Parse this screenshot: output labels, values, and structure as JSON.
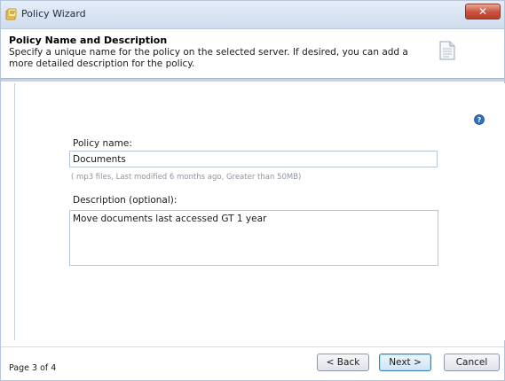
{
  "window": {
    "title": "Policy Wizard",
    "close_label": "✕",
    "app_icon": "wizard-icon"
  },
  "header": {
    "title": "Policy Name and Description",
    "description": "Specify a unique name for the policy on the selected server. If desired, you can add a more detailed description for the policy.",
    "icon": "document-icon"
  },
  "form": {
    "help_icon": "help-icon",
    "policy_name_label": "Policy name:",
    "policy_name_value": "Documents",
    "criteria_hint": "( mp3 files, Last modified  6 months ago, Greater than 50MB)",
    "description_label": "Description (optional):",
    "description_value": "Move documents last accessed GT 1 year"
  },
  "footer": {
    "page_indicator": "Page 3 of 4",
    "back_label": "< Back",
    "next_label": "Next >",
    "cancel_label": "Cancel"
  },
  "colors": {
    "titlebar": "#cfdcec",
    "close_button": "#c7503c",
    "field_border": "#b9c7d8",
    "default_button_border": "#3c7fb1"
  }
}
